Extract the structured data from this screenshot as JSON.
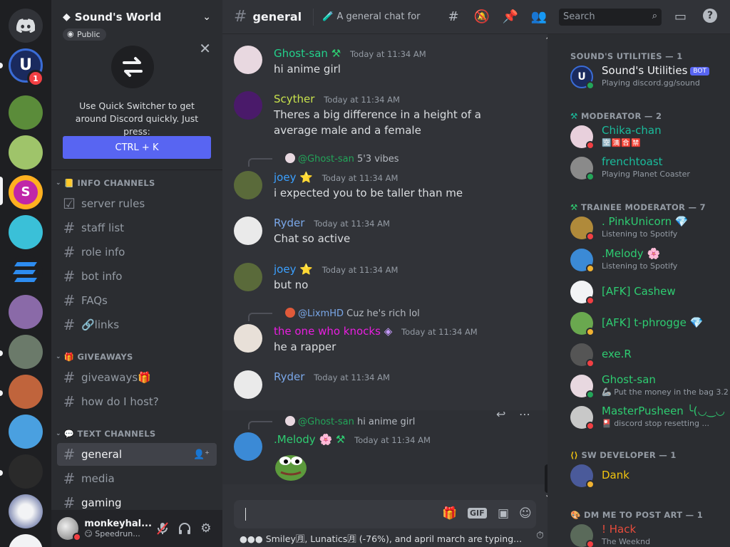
{
  "rail": {
    "unread_count": "1"
  },
  "server": {
    "name": "Sound's World",
    "visibility": "Public"
  },
  "quick_switcher": {
    "text": "Use Quick Switcher to get around Discord quickly. Just press:",
    "shortcut": "CTRL + K"
  },
  "categories": [
    {
      "label": "INFO CHANNELS",
      "emoji": "📒"
    },
    {
      "label": "GIVEAWAYS",
      "emoji": "🎁"
    },
    {
      "label": "TEXT CHANNELS",
      "emoji": "💬"
    }
  ],
  "channels": [
    {
      "name": "server rules"
    },
    {
      "name": "staff list"
    },
    {
      "name": "role info"
    },
    {
      "name": "bot info"
    },
    {
      "name": "FAQs"
    },
    {
      "name": "🔗links"
    },
    {
      "name": "giveaways🎁"
    },
    {
      "name": "how do I host?"
    },
    {
      "name": "general"
    },
    {
      "name": "media"
    },
    {
      "name": "gaming"
    }
  ],
  "user": {
    "name": "monkeyhal...",
    "status": "😏 Speedrun..."
  },
  "chat": {
    "channel": "general",
    "topic": "🧪 A general chat for peo...",
    "composer_placeholder": "",
    "typing": "●●● Smiley🈷, Lunatics🈷 (-76%), and april march are typing..."
  },
  "messages": [
    {
      "author": "Ghost-san",
      "color": "#23d18b",
      "time": "Today at 11:34 AM",
      "text": "hi anime girl"
    },
    {
      "author": "Scyther",
      "color": "#c8e24c",
      "time": "Today at 11:34 AM",
      "text": "Theres a big difference in a height of a average male and a female"
    },
    {
      "reply_name": "@Ghost-san",
      "reply_text": "5'3 vibes",
      "author": "joey ⭐",
      "color": "#3ba0ff",
      "time": "Today at 11:34 AM",
      "text": "i expected you to be taller than me"
    },
    {
      "author": "Ryder",
      "color": "#7aa7e8",
      "time": "Today at 11:34 AM",
      "text": "Chat so active"
    },
    {
      "author": "joey ⭐",
      "color": "#3ba0ff",
      "time": "Today at 11:34 AM",
      "text": "but no"
    },
    {
      "reply_name": "@LixmHD",
      "reply_text": "Cuz he's rich lol",
      "author": "the one who knocks",
      "color": "#e91ee0",
      "time": "Today at 11:34 AM",
      "text": "he a rapper"
    },
    {
      "author": "Ryder",
      "color": "#7aa7e8",
      "time": "Today at 11:34 AM",
      "text": ""
    },
    {
      "reply_name": "@Ghost-san",
      "reply_text": "hi anime girl",
      "author": ".Melody 🌸",
      "color": "#2ecc71",
      "time": "Today at 11:34 AM",
      "text": ""
    }
  ],
  "header": {
    "search_placeholder": "Search"
  },
  "roles": [
    {
      "label": "SOUND'S UTILITIES — 1"
    },
    {
      "label": "MODERATOR — 2"
    },
    {
      "label": "TRAINEE MODERATOR — 7"
    },
    {
      "label": "SW DEVELOPER — 1"
    },
    {
      "label": "DM ME TO POST ART — 1"
    }
  ],
  "members": [
    {
      "name": "Sound's Utilities",
      "bot": "BOT",
      "activity": "Playing discord.gg/sound",
      "color": "#f2f3f5",
      "status": "#23a559"
    },
    {
      "name": "Chika-chan",
      "activity": "🈳🈵🈴🈲",
      "color": "#1abc9c",
      "status": "#f23f43"
    },
    {
      "name": "frenchtoast",
      "activity": "Playing Planet Coaster",
      "color": "#1abc9c",
      "status": "#23a559"
    },
    {
      "name": ". PinkUnicorn 💎",
      "activity": "Listening to Spotify",
      "color": "#2ecc71",
      "status": "#f23f43"
    },
    {
      "name": ".Melody 🌸",
      "activity": "Listening to Spotify",
      "color": "#2ecc71",
      "status": "#f0b232"
    },
    {
      "name": "[AFK] Cashew",
      "activity": "",
      "color": "#2ecc71",
      "status": "#f23f43"
    },
    {
      "name": "[AFK] t-phrogge 💎",
      "activity": "",
      "color": "#2ecc71",
      "status": "#f0b232"
    },
    {
      "name": "exe.R",
      "activity": "",
      "color": "#2ecc71",
      "status": "#f23f43"
    },
    {
      "name": "Ghost-san",
      "activity": "🦾 Put the money in the bag 3.2",
      "color": "#2ecc71",
      "status": "#23a559"
    },
    {
      "name": "MasterPusheen ╰(◡‿◡",
      "activity": "🎴 discord stop resetting ...",
      "color": "#2ecc71",
      "status": "#f23f43"
    },
    {
      "name": "Dank",
      "activity": "",
      "color": "#f1c40f",
      "status": "#f0b232"
    },
    {
      "name": "! Hack",
      "activity": "The Weeknd",
      "color": "#e74c3c",
      "status": "#f23f43"
    }
  ]
}
